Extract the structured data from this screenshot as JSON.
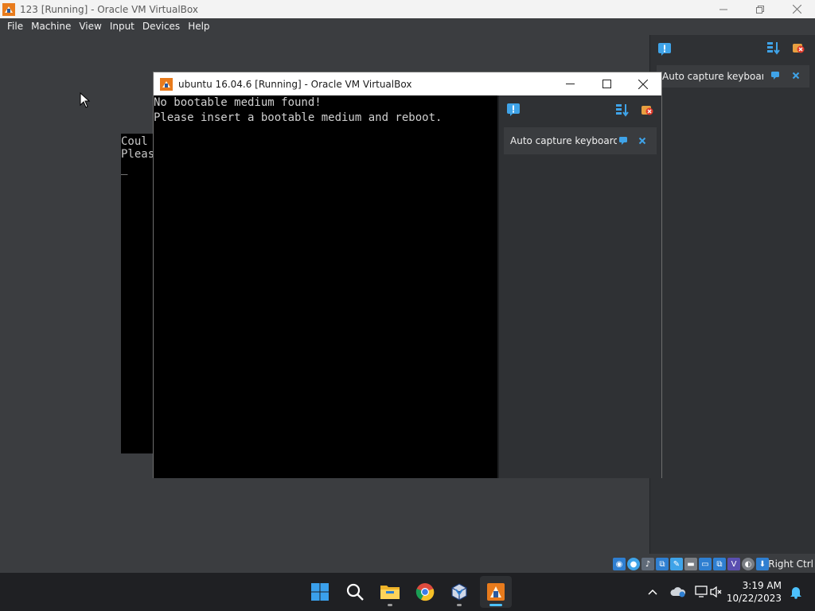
{
  "outer_window": {
    "title": "123 [Running] - Oracle VM VirtualBox",
    "menu": [
      "File",
      "Machine",
      "View",
      "Input",
      "Devices",
      "Help"
    ],
    "console_lines": [
      "Coul",
      "Pleas",
      "_"
    ]
  },
  "inner_window": {
    "title": "ubuntu 16.04.6 [Running] - Oracle VM VirtualBox",
    "console_lines": [
      "No bootable medium found!",
      "Please insert a bootable medium and reboot."
    ]
  },
  "notification": {
    "text": "Auto capture keyboard ..."
  },
  "status_bar": {
    "host_key": "Right Ctrl",
    "icons": [
      "hard-disk-icon",
      "optical-drive-icon",
      "audio-icon",
      "network-icon",
      "usb-icon",
      "shared-folders-icon",
      "display-icon",
      "recording-icon",
      "vt-x-icon",
      "mouse-integration-icon",
      "host-key-icon"
    ]
  },
  "taskbar": {
    "apps": [
      "start-button",
      "search-button",
      "file-explorer",
      "chrome",
      "virtualbox-manager",
      "virtualbox-vm"
    ],
    "active_app": "virtualbox-vm"
  },
  "clock": {
    "time": "3:19 AM",
    "date": "10/22/2023"
  },
  "colors": {
    "desktop_bg": "#3b3d40",
    "panel_bg": "#2f3134",
    "card_bg": "#3a3c3f",
    "accent": "#4cc2ff"
  }
}
